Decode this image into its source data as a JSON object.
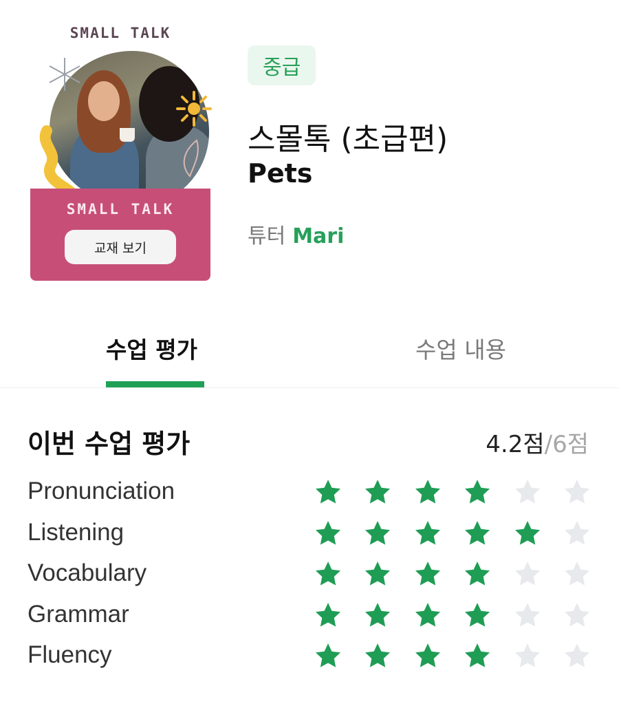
{
  "book": {
    "cover_title_top": "SMALL TALK",
    "cover_title_band": "SMALL TALK",
    "view_button_label": "교재 보기",
    "band_color": "#c74f77"
  },
  "course": {
    "level": "중급",
    "title": "스몰톡 (초급편)",
    "subtitle": "Pets",
    "tutor_label": "튜터",
    "tutor_name": "Mari"
  },
  "tabs": [
    {
      "label": "수업 평가",
      "active": true
    },
    {
      "label": "수업 내용",
      "active": false
    }
  ],
  "rating": {
    "section_title": "이번 수업 평가",
    "score_value": "4.2점",
    "score_total": "/6점",
    "max_stars": 6,
    "criteria": [
      {
        "label": "Pronunciation",
        "stars": 4
      },
      {
        "label": "Listening",
        "stars": 5
      },
      {
        "label": "Vocabulary",
        "stars": 4
      },
      {
        "label": "Grammar",
        "stars": 4
      },
      {
        "label": "Fluency",
        "stars": 4
      }
    ]
  },
  "colors": {
    "accent_green": "#20a055",
    "star_filled": "#1f9d55",
    "star_empty": "#e8e9ec",
    "level_badge_bg": "#eaf7ef"
  },
  "icons": {
    "star": "star-icon"
  }
}
